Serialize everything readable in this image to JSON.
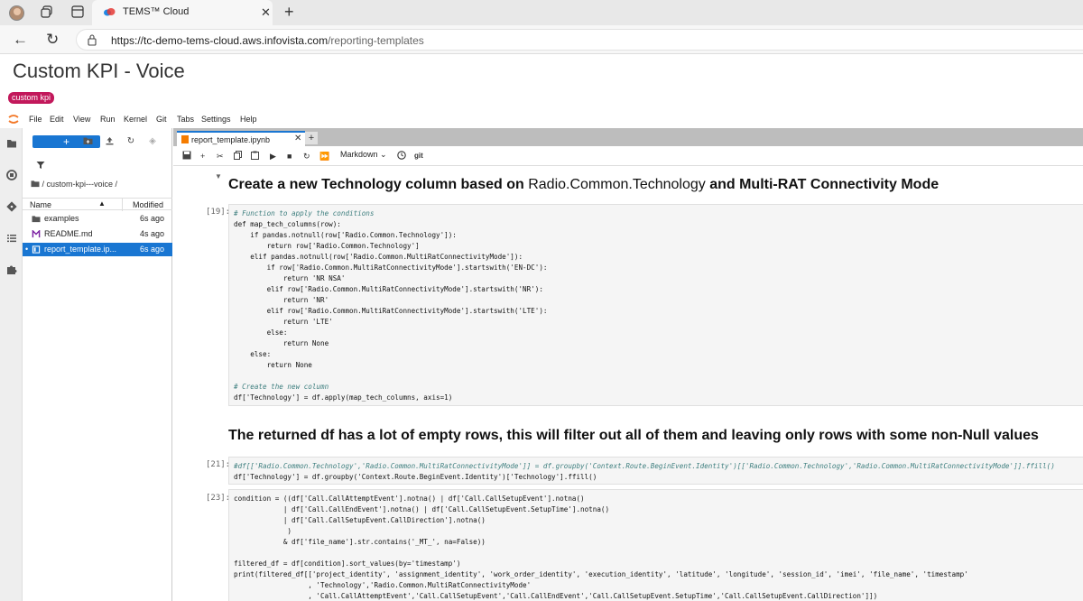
{
  "browser": {
    "tab_title": "TEMS™ Cloud",
    "url_host": "https://tc-demo-tems-cloud.aws.infovista.com",
    "url_path": "/reporting-templates"
  },
  "page": {
    "title": "Custom KPI - Voice",
    "badge": "custom kpi"
  },
  "menu": [
    "File",
    "Edit",
    "View",
    "Run",
    "Kernel",
    "Git",
    "Tabs",
    "Settings",
    "Help"
  ],
  "filebrowser": {
    "new_button": "+",
    "path": "/ custom-kpi---voice /",
    "col_name": "Name",
    "col_modified": "Modified",
    "files": [
      {
        "name": "examples",
        "modified": "6s ago",
        "type": "folder-icon"
      },
      {
        "name": "README.md",
        "modified": "4s ago",
        "type": "markdown-icon"
      },
      {
        "name": "report_template.ip...",
        "modified": "6s ago",
        "type": "notebook-icon"
      }
    ]
  },
  "notebook": {
    "tab_label": "report_template.ipynb",
    "cell_type": "Markdown",
    "git_label": "git",
    "heading1_a": "Create a new Technology column based on ",
    "heading1_b": "Radio.Common.Technology",
    "heading1_c": " and Multi-RAT Connectivity Mode",
    "prompt19": "[19]:",
    "code19": [
      "# Function to apply the conditions",
      "def map_tech_columns(row):",
      "    if pandas.notnull(row['Radio.Common.Technology']):",
      "        return row['Radio.Common.Technology']",
      "    elif pandas.notnull(row['Radio.Common.MultiRatConnectivityMode']):",
      "        if row['Radio.Common.MultiRatConnectivityMode'].startswith('EN-DC'):",
      "            return 'NR NSA'",
      "        elif row['Radio.Common.MultiRatConnectivityMode'].startswith('NR'):",
      "            return 'NR'",
      "        elif row['Radio.Common.MultiRatConnectivityMode'].startswith('LTE'):",
      "            return 'LTE'",
      "        else:",
      "            return None",
      "    else:",
      "        return None",
      "",
      "# Create the new column",
      "df['Technology'] = df.apply(map_tech_columns, axis=1)"
    ],
    "heading2": "The returned df has a lot of empty rows, this will filter out all of them and leaving only rows with some non-Null values",
    "prompt21": "[21]:",
    "code21": [
      "#df[['Radio.Common.Technology','Radio.Common.MultiRatConnectivityMode']] = df.groupby('Context.Route.BeginEvent.Identity')[['Radio.Common.Technology','Radio.Common.MultiRatConnectivityMode']].ffill()",
      "df['Technology'] = df.groupby('Context.Route.BeginEvent.Identity')['Technology'].ffill()"
    ],
    "prompt23": "[23]:",
    "code23": [
      "condition = ((df['Call.CallAttemptEvent'].notna() | df['Call.CallSetupEvent'].notna()",
      "            | df['Call.CallEndEvent'].notna() | df['Call.CallSetupEvent.SetupTime'].notna()",
      "            | df['Call.CallSetupEvent.CallDirection'].notna()",
      "             )",
      "            & df['file_name'].str.contains('_MT_', na=False))",
      "",
      "filtered_df = df[condition].sort_values(by='timestamp')",
      "print(filtered_df[['project_identity', 'assignment_identity', 'work_order_identity', 'execution_identity', 'latitude', 'longitude', 'session_id', 'imei', 'file_name', 'timestamp'",
      "                  , 'Technology','Radio.Common.MultiRatConnectivityMode'",
      "                  , 'Call.CallAttemptEvent','Call.CallSetupEvent','Call.CallEndEvent','Call.CallSetupEvent.SetupTime','Call.CallSetupEvent.CallDirection']])"
    ]
  }
}
